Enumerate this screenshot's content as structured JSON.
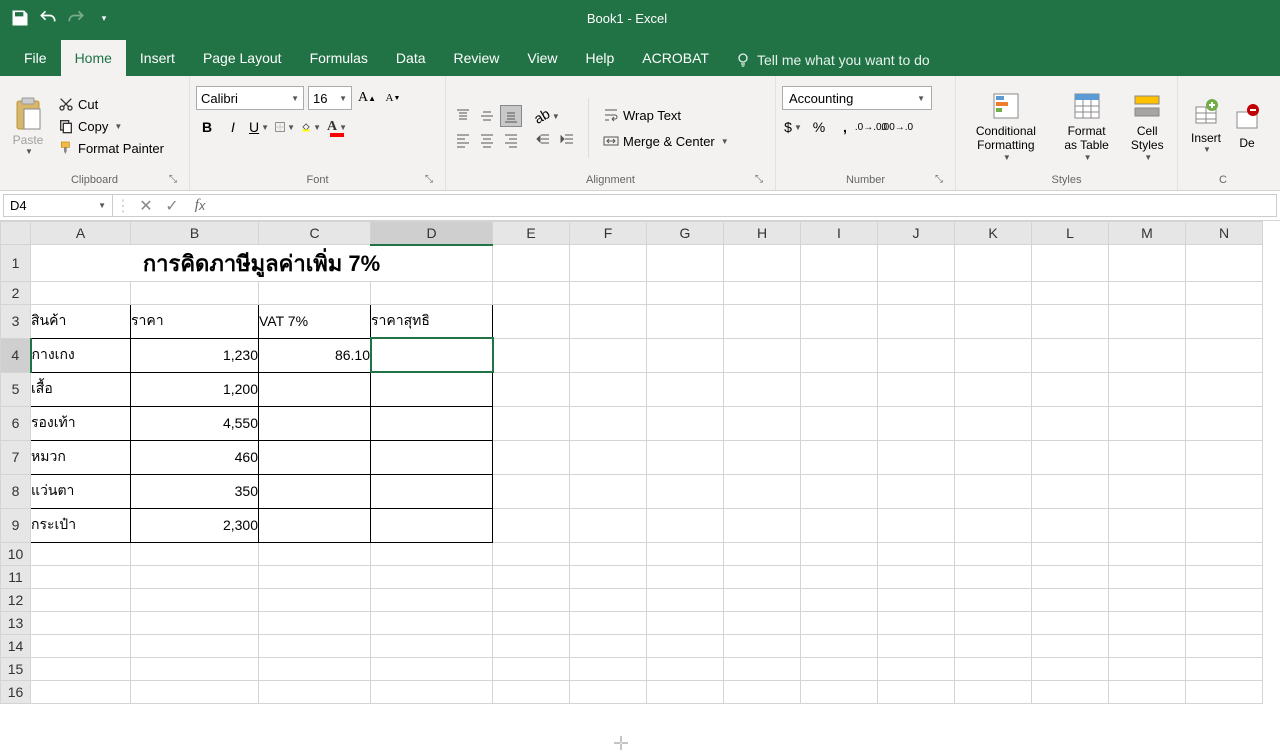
{
  "title": "Book1  -  Excel",
  "tabs": {
    "file": "File",
    "home": "Home",
    "insert": "Insert",
    "page_layout": "Page Layout",
    "formulas": "Formulas",
    "data": "Data",
    "review": "Review",
    "view": "View",
    "help": "Help",
    "acrobat": "ACROBAT",
    "tellme": "Tell me what you want to do"
  },
  "clipboard": {
    "paste": "Paste",
    "cut": "Cut",
    "copy": "Copy",
    "painter": "Format Painter",
    "label": "Clipboard"
  },
  "font": {
    "name": "Calibri",
    "size": "16",
    "label": "Font"
  },
  "alignment": {
    "wrap": "Wrap Text",
    "merge": "Merge & Center",
    "label": "Alignment"
  },
  "number": {
    "format": "Accounting",
    "label": "Number"
  },
  "styles": {
    "cond": "Conditional Formatting",
    "table": "Format as Table",
    "cell": "Cell Styles",
    "label": "Styles"
  },
  "cells": {
    "insert": "Insert",
    "delete": "De"
  },
  "namebox": "D4",
  "cols": [
    "A",
    "B",
    "C",
    "D",
    "E",
    "F",
    "G",
    "H",
    "I",
    "J",
    "K",
    "L",
    "M",
    "N"
  ],
  "sheet": {
    "title": "การคิดภาษีมูลค่าเพิ่ม 7%",
    "hdr": {
      "a": "สินค้า",
      "b": "ราคา",
      "c": "VAT 7%",
      "d": "ราคาสุทธิ"
    },
    "rows": [
      {
        "a": "กางเกง",
        "b": "1,230",
        "c": "86.10",
        "d": ""
      },
      {
        "a": "เสื้อ",
        "b": "1,200",
        "c": "",
        "d": ""
      },
      {
        "a": "รองเท้า",
        "b": "4,550",
        "c": "",
        "d": ""
      },
      {
        "a": "หมวก",
        "b": "460",
        "c": "",
        "d": ""
      },
      {
        "a": "แว่นตา",
        "b": "350",
        "c": "",
        "d": ""
      },
      {
        "a": "กระเป๋า",
        "b": "2,300",
        "c": "",
        "d": ""
      }
    ]
  }
}
